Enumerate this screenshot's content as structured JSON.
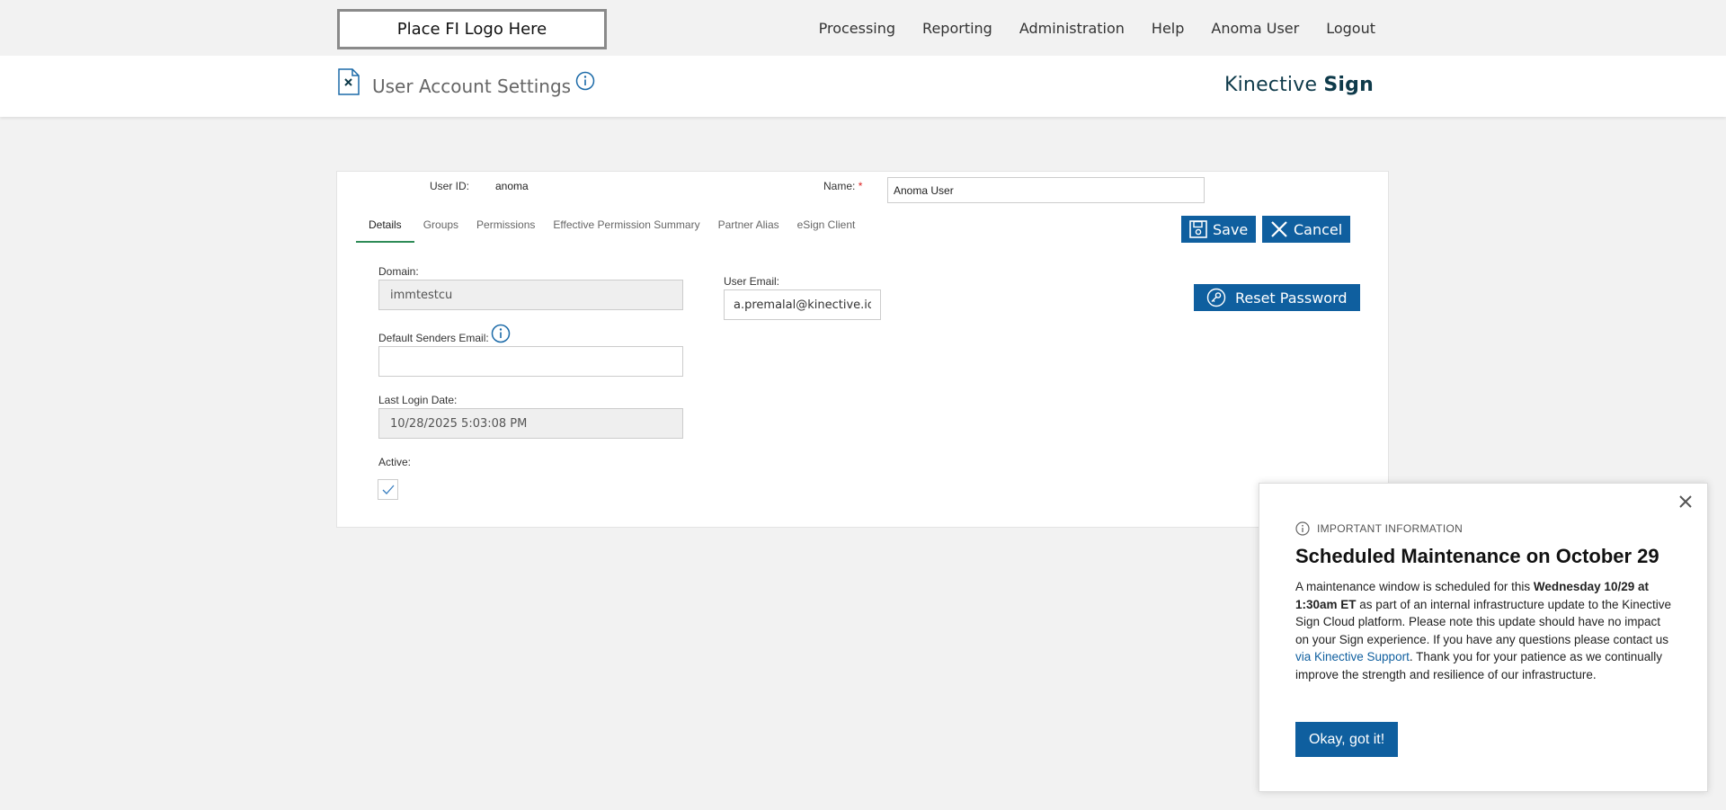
{
  "header": {
    "logo_text": "Place FI Logo Here",
    "nav": [
      "Processing",
      "Reporting",
      "Administration",
      "Help",
      "Anoma User",
      "Logout"
    ],
    "page_title": "User Account Settings",
    "brand_light": "Kinective ",
    "brand_bold": "Sign"
  },
  "form": {
    "user_id_label": "User ID:",
    "user_id_value": "anoma",
    "name_label": "Name:",
    "name_required": "*",
    "name_value": "Anoma User",
    "tabs": [
      "Details",
      "Groups",
      "Permissions",
      "Effective Permission Summary",
      "Partner Alias",
      "eSign Client"
    ],
    "active_tab": "Details",
    "save_label": "Save",
    "cancel_label": "Cancel",
    "reset_password_label": "Reset Password",
    "domain_label": "Domain:",
    "domain_value": "immtestcu",
    "default_senders_email_label": "Default Senders Email:",
    "default_senders_email_value": "",
    "last_login_label": "Last Login Date:",
    "last_login_value": "10/28/2025 5:03:08 PM",
    "active_label": "Active:",
    "active_checked": true,
    "user_email_label": "User Email:",
    "user_email_value": "a.premalal@kinective.io"
  },
  "popup": {
    "kicker": "IMPORTANT INFORMATION",
    "title": "Scheduled Maintenance on October 29",
    "body_1": "A maintenance window is scheduled for this ",
    "body_bold": "Wednesday 10/29 at 1:30am ET",
    "body_2": " as part of an internal infrastructure update to the Kinective Sign Cloud platform. Please note this update should have no impact on your Sign experience. If you have any questions please contact us ",
    "body_link": "via Kinective Support",
    "body_3": ". Thank you for your patience as we continually improve the strength and resilience of our infrastructure.",
    "ok_label": "Okay, got it!"
  },
  "colors": {
    "primary": "#0f5f9f",
    "brand": "#0e3a4a",
    "tab_underline": "#2e8b57"
  }
}
